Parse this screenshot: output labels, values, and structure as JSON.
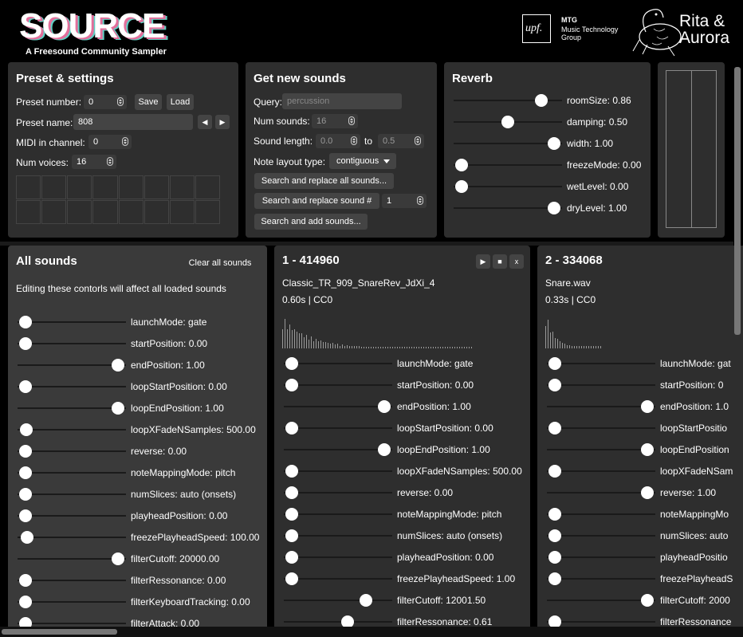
{
  "header": {
    "logo_text": "SOURCE",
    "subtitle": "A Freesound Community Sampler",
    "upf_logo_text": "upf.",
    "mtg_title": "MTG",
    "mtg_line1": "Music Technology",
    "mtg_line2": "Group",
    "rita_logo_text": "Rita & Aurora"
  },
  "preset": {
    "title": "Preset & settings",
    "preset_number_label": "Preset number:",
    "preset_number_value": "0",
    "save_label": "Save",
    "load_label": "Load",
    "preset_name_label": "Preset name:",
    "preset_name_value": "808",
    "prev_symbol": "◀",
    "next_symbol": "▶",
    "midi_label": "MIDI in channel:",
    "midi_value": "0",
    "voices_label": "Num voices:",
    "voices_value": "16"
  },
  "get_sounds": {
    "title": "Get new sounds",
    "query_label": "Query:",
    "query_placeholder": "percussion",
    "num_sounds_label": "Num sounds:",
    "num_sounds_value": "16",
    "sound_length_label": "Sound length:",
    "length_min": "0.0",
    "to_label": "to",
    "length_max": "0.5",
    "note_layout_label": "Note layout type:",
    "note_layout_value": "contiguous",
    "replace_all_label": "Search and replace all sounds...",
    "replace_one_label": "Search and replace sound #",
    "replace_one_value": "1",
    "add_label": "Search and add sounds..."
  },
  "reverb": {
    "title": "Reverb",
    "params": [
      {
        "label": "roomSize: 0.86",
        "value": 0.86
      },
      {
        "label": "damping: 0.50",
        "value": 0.5
      },
      {
        "label": "width: 1.00",
        "value": 1.0
      },
      {
        "label": "freezeMode: 0.00",
        "value": 0.0
      },
      {
        "label": "wetLevel: 0.00",
        "value": 0.0
      },
      {
        "label": "dryLevel: 1.00",
        "value": 1.0
      }
    ]
  },
  "all_sounds": {
    "title": "All sounds",
    "clear_label": "Clear all sounds",
    "description": "Editing these contorls will affect all loaded sounds",
    "params": [
      {
        "label": "launchMode: gate",
        "value": 0.0
      },
      {
        "label": "startPosition: 0.00",
        "value": 0.0
      },
      {
        "label": "endPosition: 1.00",
        "value": 1.0
      },
      {
        "label": "loopStartPosition: 0.00",
        "value": 0.0
      },
      {
        "label": "loopEndPosition: 1.00",
        "value": 1.0
      },
      {
        "label": "loopXFadeNSamples: 500.00",
        "value": 0.01
      },
      {
        "label": "reverse: 0.00",
        "value": 0.0
      },
      {
        "label": "noteMappingMode: pitch",
        "value": 0.0
      },
      {
        "label": "numSlices: auto (onsets)",
        "value": 0.0
      },
      {
        "label": "playheadPosition: 0.00",
        "value": 0.0
      },
      {
        "label": "freezePlayheadSpeed: 100.00",
        "value": 0.02
      },
      {
        "label": "filterCutoff: 20000.00",
        "value": 1.0
      },
      {
        "label": "filterRessonance: 0.00",
        "value": 0.0
      },
      {
        "label": "filterKeyboardTracking: 0.00",
        "value": 0.0
      },
      {
        "label": "filterAttack: 0.00",
        "value": 0.0
      }
    ]
  },
  "sound1": {
    "title": "1 - 414960",
    "name": "Classic_TR_909_SnareRev_JdXi_4",
    "info": "0.60s | CC0",
    "play_symbol": "▶",
    "stop_symbol": "■",
    "close_symbol": "x",
    "params": [
      {
        "label": "launchMode: gate",
        "value": 0.0
      },
      {
        "label": "startPosition: 0.00",
        "value": 0.0
      },
      {
        "label": "endPosition: 1.00",
        "value": 1.0
      },
      {
        "label": "loopStartPosition: 0.00",
        "value": 0.0
      },
      {
        "label": "loopEndPosition: 1.00",
        "value": 1.0
      },
      {
        "label": "loopXFadeNSamples: 500.00",
        "value": 0.0
      },
      {
        "label": "reverse: 0.00",
        "value": 0.0
      },
      {
        "label": "noteMappingMode: pitch",
        "value": 0.0
      },
      {
        "label": "numSlices: auto (onsets)",
        "value": 0.0
      },
      {
        "label": "playheadPosition: 0.00",
        "value": 0.0
      },
      {
        "label": "freezePlayheadSpeed: 1.00",
        "value": 0.0
      },
      {
        "label": "filterCutoff: 12001.50",
        "value": 0.8
      },
      {
        "label": "filterRessonance: 0.61",
        "value": 0.6
      }
    ]
  },
  "sound2": {
    "title": "2 - 334068",
    "name": "Snare.wav",
    "info": "0.33s | CC0",
    "params": [
      {
        "label": "launchMode: gat",
        "value": 0.0
      },
      {
        "label": "startPosition: 0",
        "value": 0.0
      },
      {
        "label": "endPosition: 1.0",
        "value": 1.0
      },
      {
        "label": "loopStartPositio",
        "value": 0.0
      },
      {
        "label": "loopEndPosition",
        "value": 1.0
      },
      {
        "label": "loopXFadeNSam",
        "value": 0.0
      },
      {
        "label": "reverse: 1.00",
        "value": 1.0
      },
      {
        "label": "noteMappingMo",
        "value": 0.0
      },
      {
        "label": "numSlices: auto",
        "value": 0.0
      },
      {
        "label": "playheadPositio",
        "value": 0.0
      },
      {
        "label": "freezePlayheadS",
        "value": 0.0
      },
      {
        "label": "filterCutoff: 2000",
        "value": 1.0
      },
      {
        "label": "filterRessonance",
        "value": 0.0
      }
    ]
  },
  "colors": {
    "panel": "#2e2e2e",
    "panel_light": "#3a3a3a",
    "logo_pink": "#e26f9b",
    "logo_teal": "#5fd0c4"
  }
}
